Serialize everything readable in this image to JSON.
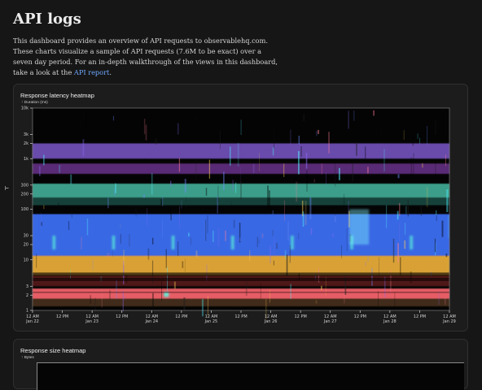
{
  "header": {
    "title": "API logs",
    "intro": {
      "part1": "This dashboard provides an overview of API requests to observablehq.com. These charts visualize a sample of API requests (7.6M to be exact) over a seven day period. For an in-depth walkthrough of the views in this dashboard, take a look at the ",
      "link": "API report",
      "suffix": "."
    },
    "side_marker": "⊢"
  },
  "cards": [
    {
      "title": "Response latency heatmap",
      "ylabel": "↑ Duration (ms)"
    },
    {
      "title": "Response size heatmap",
      "ylabel": "↑ Bytes"
    }
  ],
  "chart_data": [
    {
      "type": "heatmap",
      "title": "Response latency heatmap",
      "xlabel": "",
      "ylabel": "↑ Duration (ms)",
      "y_scale": "log",
      "grid": false,
      "legend": "none",
      "y_ticks": [
        "10k",
        "3k",
        "2k",
        "1k",
        "300",
        "200",
        "100",
        "30",
        "20",
        "10",
        "3",
        "2",
        "1"
      ],
      "y_tick_values": [
        10000,
        3000,
        2000,
        1000,
        300,
        200,
        100,
        30,
        20,
        10,
        3,
        2,
        1
      ],
      "x_ticks": [
        {
          "top": "12 AM",
          "bottom": "Jan 22"
        },
        {
          "top": "12 PM",
          "bottom": ""
        },
        {
          "top": "12 AM",
          "bottom": "Jan 23"
        },
        {
          "top": "12 PM",
          "bottom": ""
        },
        {
          "top": "12 AM",
          "bottom": "Jan 24"
        },
        {
          "top": "12 PM",
          "bottom": ""
        },
        {
          "top": "12 AM",
          "bottom": "Jan 25"
        },
        {
          "top": "12 PM",
          "bottom": ""
        },
        {
          "top": "12 AM",
          "bottom": "Jan 26"
        },
        {
          "top": "12 PM",
          "bottom": ""
        },
        {
          "top": "12 AM",
          "bottom": "Jan 27"
        },
        {
          "top": "12 PM",
          "bottom": ""
        },
        {
          "top": "12 AM",
          "bottom": "Jan 28"
        },
        {
          "top": "12 PM",
          "bottom": ""
        },
        {
          "top": "12 AM",
          "bottom": "Jan 29"
        }
      ],
      "bands": [
        {
          "y_from": 1000,
          "y_to": 2000,
          "color": "#7b57c9",
          "intensity": 0.85
        },
        {
          "y_from": 500,
          "y_to": 800,
          "color": "#a04ad4",
          "intensity": 0.55
        },
        {
          "y_from": 170,
          "y_to": 320,
          "color": "#4fd1b7",
          "intensity": 0.75
        },
        {
          "y_from": 120,
          "y_to": 170,
          "color": "#2e8c7d",
          "intensity": 0.45
        },
        {
          "y_from": 12,
          "y_to": 80,
          "color": "#3d6df0",
          "intensity": 0.95
        },
        {
          "y_from": 5,
          "y_to": 12,
          "color": "#f1b23a",
          "intensity": 0.9
        },
        {
          "y_from": 3,
          "y_to": 5,
          "color": "#8c2b2b",
          "intensity": 0.55
        },
        {
          "y_from": 1.7,
          "y_to": 2.7,
          "color": "#ff6670",
          "intensity": 0.9
        },
        {
          "y_from": 1.2,
          "y_to": 1.7,
          "color": "#8c5b36",
          "intensity": 0.45
        }
      ]
    },
    {
      "type": "heatmap",
      "title": "Response size heatmap",
      "xlabel": "",
      "ylabel": "↑ Bytes",
      "grid": false,
      "legend": "none"
    }
  ]
}
